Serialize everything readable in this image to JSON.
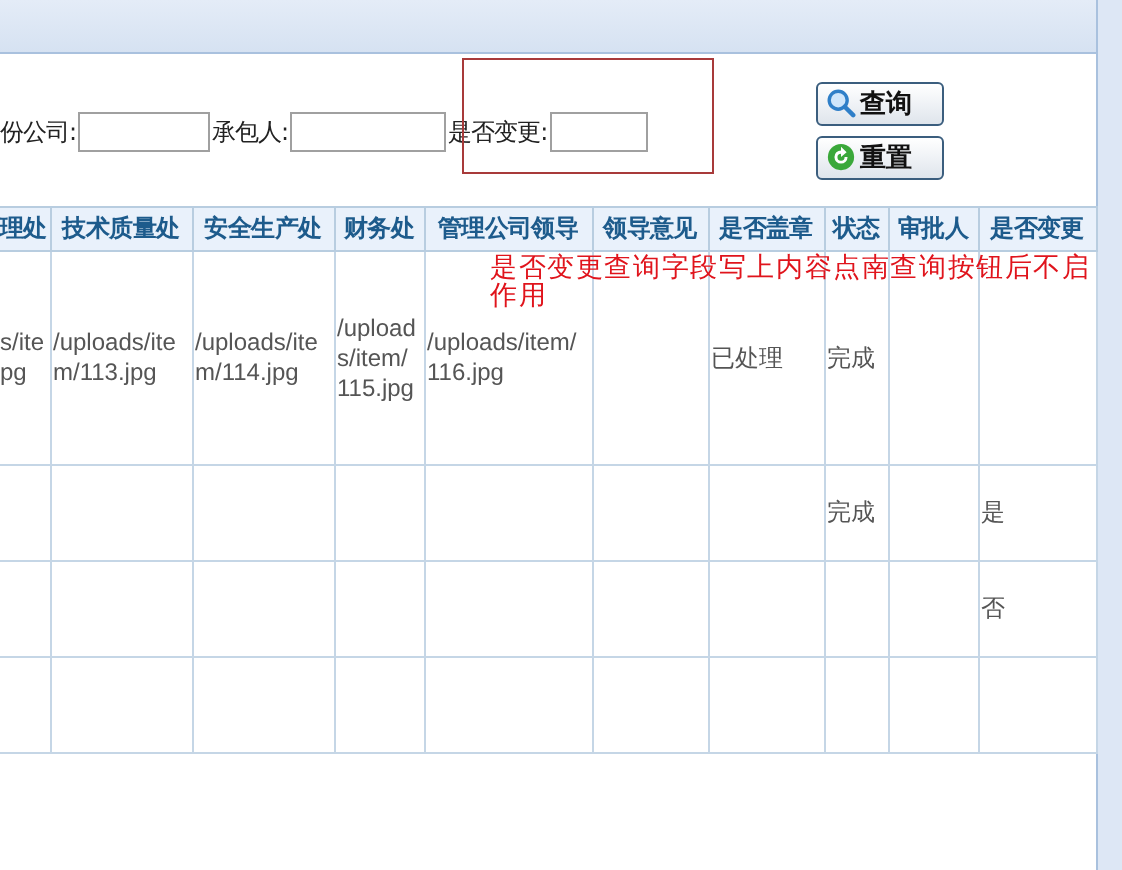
{
  "filters": [
    {
      "label": "份公司:"
    },
    {
      "label": "承包人:"
    },
    {
      "label": "是否变更:"
    }
  ],
  "buttons": [
    {
      "label": "查询",
      "kind": "search"
    },
    {
      "label": "重置",
      "kind": "reset"
    }
  ],
  "annotation": "是否变更查询字段写上内容点南查询按钮后不启作用",
  "table": {
    "columns": [
      "理处",
      "技术质量处",
      "安全生产处",
      "财务处",
      "管理公司领导",
      "领导意见",
      "是否盖章",
      "状态",
      "审批人",
      "是否变更"
    ],
    "rows": [
      [
        "s/ite\npg",
        "/uploads/item/113.jpg",
        "/uploads/item/114.jpg",
        "/uploads/item/115.jpg",
        "/uploads/item/116.jpg",
        "",
        "已处理",
        "完成",
        "",
        ""
      ],
      [
        "",
        "",
        "",
        "",
        "",
        "",
        "",
        "完成",
        "",
        "是"
      ],
      [
        "",
        "",
        "",
        "",
        "",
        "",
        "",
        "",
        "",
        "否"
      ],
      [
        "",
        "",
        "",
        "",
        "",
        "",
        "",
        "",
        "",
        ""
      ]
    ]
  }
}
